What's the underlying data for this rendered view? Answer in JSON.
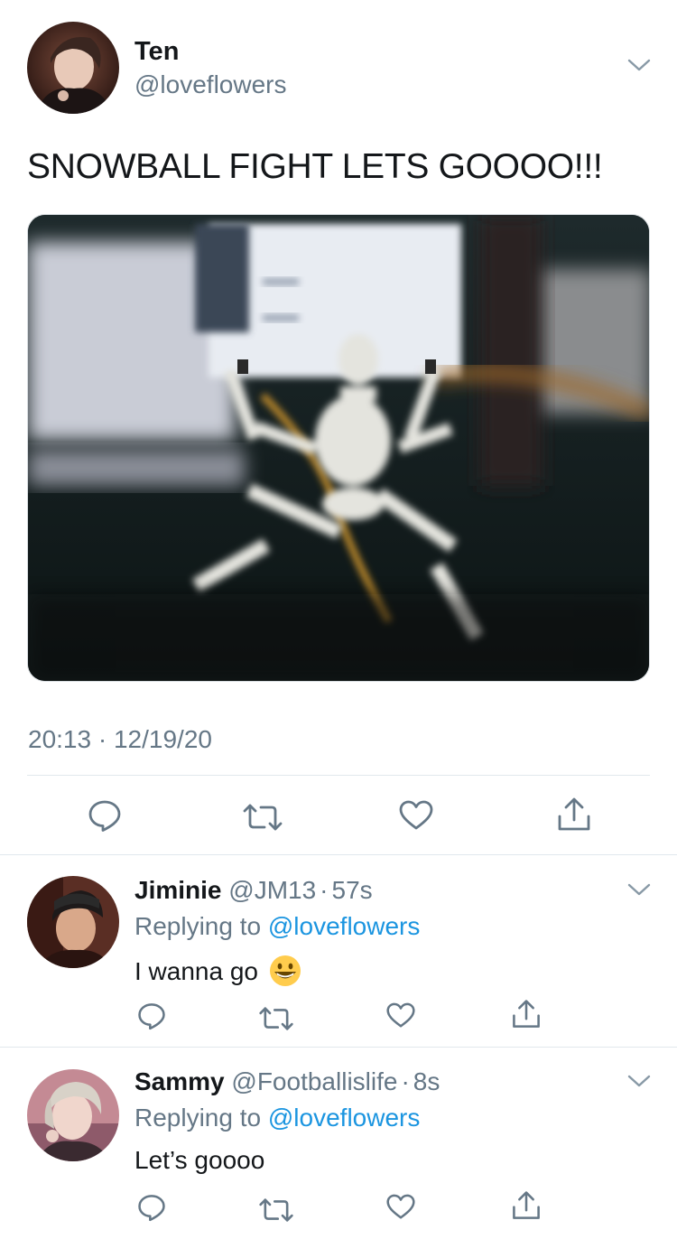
{
  "main_tweet": {
    "author_name": "Ten",
    "author_handle": "@loveflowers",
    "text": "SNOWBALL FIGHT LETS GOOOO!!!",
    "time": "20:13",
    "separator": "·",
    "date": "12/19/20"
  },
  "replies": [
    {
      "name": "Jiminie",
      "handle": "@JM13",
      "dot": "·",
      "age": "57s",
      "replying_prefix": "Replying to",
      "replying_to": "@loveflowers",
      "text": "I wanna go",
      "emoji": "grinning-face-emoji"
    },
    {
      "name": "Sammy",
      "handle": "@Footballislife",
      "dot": "·",
      "age": "8s",
      "replying_prefix": "Replying to",
      "replying_to": "@loveflowers",
      "text": "Let’s goooo"
    }
  ],
  "icons": {
    "reply": "reply-icon",
    "retweet": "retweet-icon",
    "like": "heart-icon",
    "share": "share-icon",
    "more": "chevron-down-icon"
  },
  "colors": {
    "link_blue": "#1b95e0",
    "secondary_gray": "#657786",
    "icon_gray": "#657786",
    "divider": "#e1e8ed"
  }
}
